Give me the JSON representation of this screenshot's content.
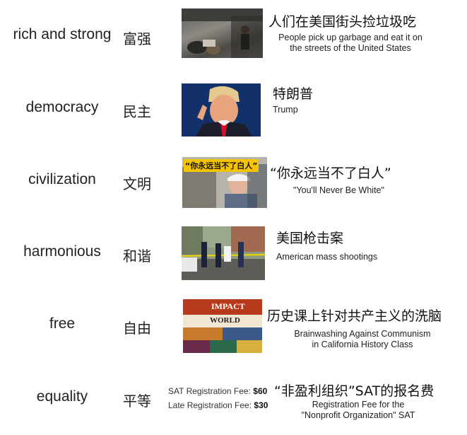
{
  "rows": [
    {
      "en": "rich and strong",
      "zh": "富强",
      "caption_zh": "人们在美国街头捡垃圾吃",
      "caption_en": [
        "People pick up garbage and eat it on",
        "the streets of the United States"
      ]
    },
    {
      "en": "democracy",
      "zh": "民主",
      "caption_zh": "特朗普",
      "caption_en": [
        "Trump"
      ]
    },
    {
      "en": "civilization",
      "zh": "文明",
      "caption_zh": "“你永远当不了白人”",
      "caption_en": [
        "\"You'll Never Be White\""
      ],
      "image_text": "“你永远当不了白人”"
    },
    {
      "en": "harmonious",
      "zh": "和谐",
      "caption_zh": "美国枪击案",
      "caption_en": [
        "American mass shootings"
      ]
    },
    {
      "en": "free",
      "zh": "自由",
      "caption_zh": "历史课上针对共产主义的洗脑",
      "caption_en": [
        "Brainwashing Against Communism",
        "in California History Class"
      ],
      "image_text": [
        "IMPACT",
        "WORLD"
      ]
    },
    {
      "en": "equality",
      "zh": "平等",
      "caption_zh": "“非盈利组织”SAT的报名费",
      "caption_en": [
        "Registration Fee for the",
        "\"Nonprofit Organization\" SAT"
      ],
      "sat_lines": [
        {
          "label": "SAT Registration Fee:",
          "value": "$60"
        },
        {
          "label": "Late Registration Fee:",
          "value": "$30"
        }
      ]
    }
  ]
}
